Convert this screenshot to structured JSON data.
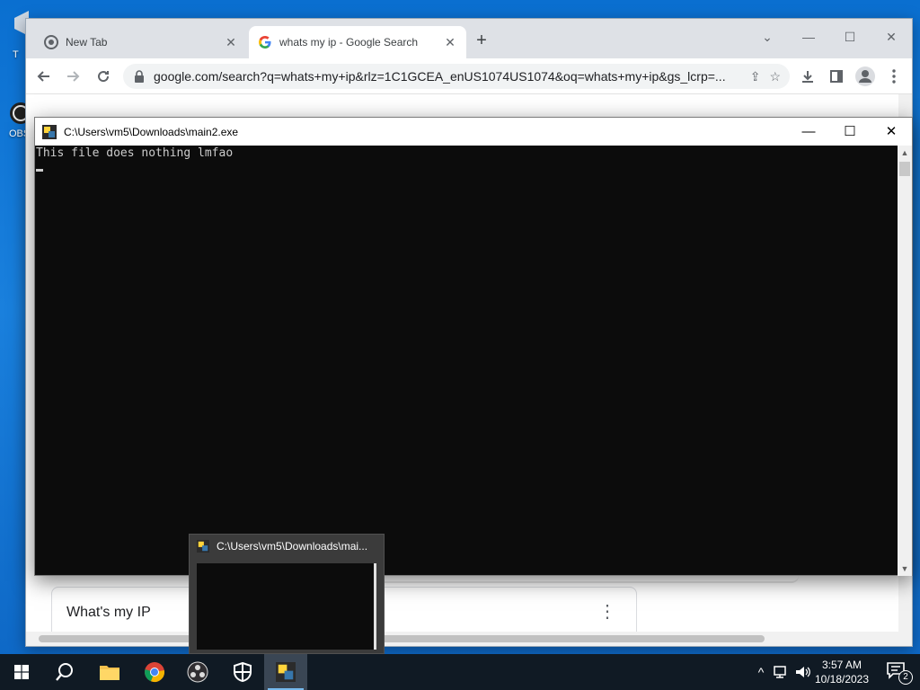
{
  "desktop": {
    "icon_labels": [
      "T",
      "OBS"
    ]
  },
  "chrome": {
    "tabs": [
      {
        "label": "New Tab",
        "active": false
      },
      {
        "label": "whats my ip - Google Search",
        "active": true
      }
    ],
    "new_tab_glyph": "+",
    "url": "google.com/search?q=whats+my+ip&rlz=1C1GCEA_enUS1074US1074&oq=whats+my+ip&gs_lcrp=...",
    "result_card_title": "What's my IP",
    "accent_color": "#1a73e8"
  },
  "console": {
    "title": "C:\\Users\\vm5\\Downloads\\main2.exe",
    "output": "This file does nothing lmfao"
  },
  "preview": {
    "title": "C:\\Users\\vm5\\Downloads\\mai..."
  },
  "taskbar": {
    "apps": [
      "start-icon",
      "search-icon",
      "file-explorer-icon",
      "chrome-icon",
      "obs-icon",
      "security-icon",
      "console-app-icon"
    ],
    "time": "3:57 AM",
    "date": "10/18/2023",
    "notification_count": "2"
  }
}
